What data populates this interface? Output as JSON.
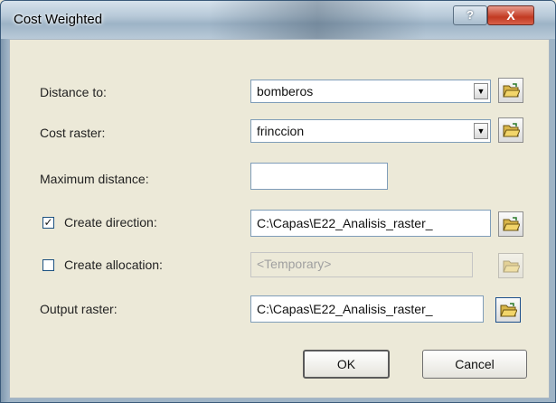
{
  "window": {
    "title": "Cost Weighted",
    "help_label": "?",
    "close_label": "X"
  },
  "form": {
    "distance_to": {
      "label": "Distance to:",
      "value": "bomberos"
    },
    "cost_raster": {
      "label": "Cost raster:",
      "value": "frinccion"
    },
    "max_distance": {
      "label": "Maximum distance:",
      "value": ""
    },
    "create_direction": {
      "label": "Create direction:",
      "checked": true,
      "value": "C:\\Capas\\E22_Analisis_raster_"
    },
    "create_allocation": {
      "label": "Create allocation:",
      "checked": false,
      "value": "<Temporary>"
    },
    "output_raster": {
      "label": "Output raster:",
      "value": "C:\\Capas\\E22_Analisis_raster_"
    }
  },
  "buttons": {
    "ok": "OK",
    "cancel": "Cancel"
  },
  "icons": {
    "dropdown": "chevron-down-icon",
    "browse": "open-folder-icon",
    "check": "✓"
  }
}
